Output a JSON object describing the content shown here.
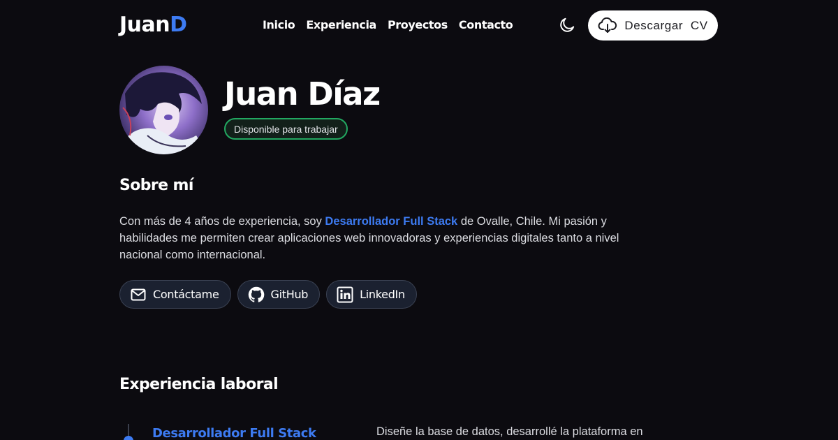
{
  "header": {
    "logo_main": "Juan",
    "logo_accent": "D",
    "nav": [
      {
        "label": "Inicio"
      },
      {
        "label": "Experiencia"
      },
      {
        "label": "Proyectos"
      },
      {
        "label": "Contacto"
      }
    ],
    "theme_icon": "moon-icon",
    "cv_button": {
      "label": "Descargar  CV",
      "icon": "cloud-download-icon"
    }
  },
  "hero": {
    "name": "Juan Díaz",
    "badge": "Disponible para trabajar",
    "badge_color": "#22a861"
  },
  "about": {
    "title": "Sobre mí",
    "text_before": "Con más de 4 años de experiencia, soy ",
    "highlight": "Desarrollador Full Stack",
    "text_after": " de Ovalle, Chile. Mi pasión y habilidades me permiten crear aplicaciones web innovadoras y experiencias digitales tanto a nivel nacional como internacional.",
    "links": [
      {
        "label": "Contáctame",
        "icon": "mail-icon"
      },
      {
        "label": "GitHub",
        "icon": "github-icon"
      },
      {
        "label": "LinkedIn",
        "icon": "linkedin-icon"
      }
    ]
  },
  "experience": {
    "title": "Experiencia laboral",
    "jobs": [
      {
        "title": "Desarrollador Full Stack",
        "description": "Diseñe la base de datos, desarrollé la plataforma en"
      }
    ]
  },
  "colors": {
    "background": "#0c0b10",
    "accent": "#3d7bf2",
    "pill_bg": "#1b2130"
  }
}
